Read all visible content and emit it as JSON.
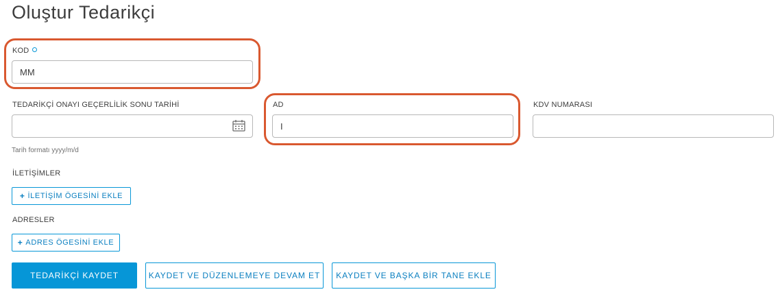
{
  "page": {
    "title": "Oluştur Tedarikçi"
  },
  "form": {
    "code": {
      "label": "KOD",
      "value": "MM"
    },
    "approval_expiry": {
      "label": "TEDARİKÇİ ONAYI GEÇERLİLİK SONU TARİHİ",
      "value": "",
      "hint": "Tarih formatı yyyy/m/d",
      "icon": "calendar-icon"
    },
    "name": {
      "label": "AD",
      "value": "I"
    },
    "vat_number": {
      "label": "KDV NUMARASI",
      "value": ""
    }
  },
  "contacts": {
    "label": "İLETİŞİMLER",
    "add_button": "İLETİŞİM ÖGESİNİ EKLE",
    "icon": "plus-icon"
  },
  "addresses": {
    "label": "ADRESLER",
    "add_button": "ADRES ÖGESİNİ EKLE",
    "icon": "plus-icon"
  },
  "actions": {
    "save": "TEDARİKÇİ KAYDET",
    "save_continue": "KAYDET VE DÜZENLEMEYE DEVAM ET",
    "save_add_another": "KAYDET VE BAŞKA BİR TANE EKLE"
  },
  "colors": {
    "accent": "#0696d7",
    "highlight": "#d9582f",
    "text": "#3c3c3c",
    "border": "#b7b7b7"
  }
}
